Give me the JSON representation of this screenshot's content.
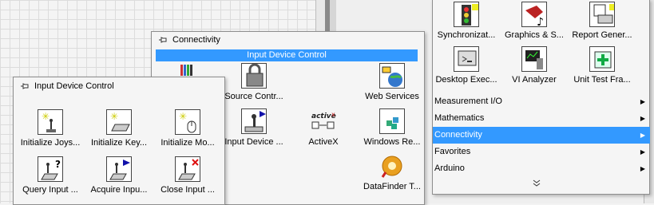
{
  "colors": {
    "highlight": "#3399ff",
    "palette_bg": "#f5f5f5",
    "border": "#8e8e8e"
  },
  "right_palette": {
    "icons": [
      {
        "label": "Synchronizat...",
        "icon": "traffic-light-icon"
      },
      {
        "label": "Graphics & S...",
        "icon": "graphics-sound-icon"
      },
      {
        "label": "Report Gener...",
        "icon": "report-printer-icon"
      },
      {
        "label": "Desktop Exec...",
        "icon": "desktop-execution-icon"
      },
      {
        "label": "VI Analyzer",
        "icon": "microscope-icon"
      },
      {
        "label": "Unit Test Fra...",
        "icon": "unit-test-icon"
      }
    ],
    "categories": [
      {
        "label": "Measurement I/O",
        "selected": false
      },
      {
        "label": "Mathematics",
        "selected": false
      },
      {
        "label": "Connectivity",
        "selected": true
      },
      {
        "label": "Favorites",
        "selected": false
      },
      {
        "label": "Arduino",
        "selected": false
      }
    ],
    "more_glyph": "⌄⌄"
  },
  "connectivity_palette": {
    "title": "Connectivity",
    "subtitle": "Input Device Control",
    "items": [
      {
        "label": "",
        "icon": "library-icon"
      },
      {
        "label": "Source Contr...",
        "icon": "source-control-icon"
      },
      {
        "label": "Web Services",
        "icon": "web-services-icon"
      },
      {
        "label": "Input Device ...",
        "icon": "input-device-icon"
      },
      {
        "label": "ActiveX",
        "icon": "activex-icon"
      },
      {
        "label": "Windows Re...",
        "icon": "windows-registry-icon"
      },
      {
        "label": "DataFinder T...",
        "icon": "datafinder-icon"
      }
    ]
  },
  "input_device_palette": {
    "title": "Input Device Control",
    "items": [
      {
        "label": "Initialize Joys...",
        "icon": "joystick-init-icon"
      },
      {
        "label": "Initialize Key...",
        "icon": "keyboard-init-icon"
      },
      {
        "label": "Initialize Mo...",
        "icon": "mouse-init-icon"
      },
      {
        "label": "Query Input ...",
        "icon": "query-input-icon"
      },
      {
        "label": "Acquire Inpu...",
        "icon": "acquire-input-icon"
      },
      {
        "label": "Close Input ...",
        "icon": "close-input-icon"
      }
    ]
  }
}
